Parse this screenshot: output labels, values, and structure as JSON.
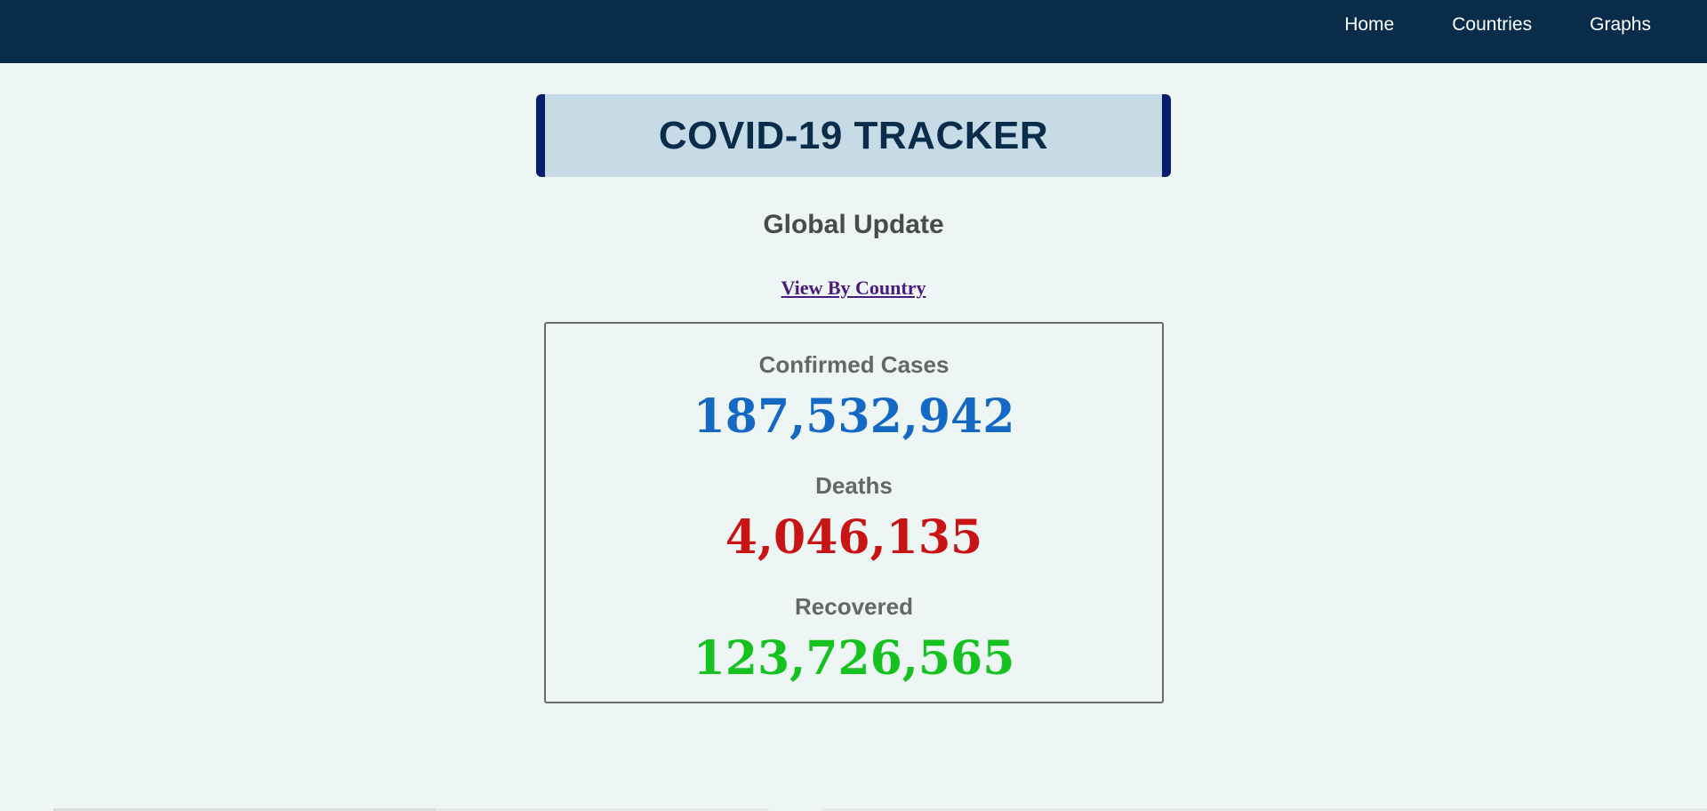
{
  "nav": {
    "items": [
      {
        "label": "Home"
      },
      {
        "label": "Countries"
      },
      {
        "label": "Graphs"
      }
    ]
  },
  "header": {
    "title": "COVID-19 TRACKER"
  },
  "main": {
    "subtitle": "Global Update",
    "view_by_country_link": "View By Country",
    "stats": [
      {
        "label": "Confirmed Cases",
        "value": "187,532,942",
        "color": "#1469c4"
      },
      {
        "label": "Deaths",
        "value": "4,046,135",
        "color": "#c81414"
      },
      {
        "label": "Recovered",
        "value": "123,726,565",
        "color": "#16c21f"
      }
    ]
  },
  "colors": {
    "navbar": "#0a2c4b",
    "title_background": "#c6dbe6",
    "title_accent": "#0a1d6c",
    "page_background": "#eef5f5"
  }
}
